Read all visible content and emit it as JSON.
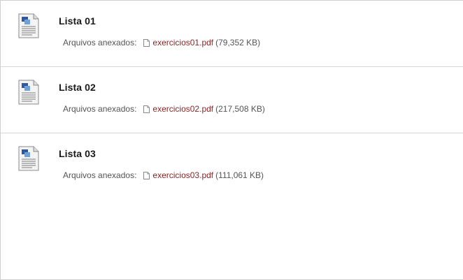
{
  "items": [
    {
      "title": "Lista 01",
      "attachments_label": "Arquivos anexados:",
      "file_name": "exercicios01.pdf",
      "file_size": "(79,352 KB)",
      "icon": "document-icon"
    },
    {
      "title": "Lista 02",
      "attachments_label": "Arquivos anexados:",
      "file_name": "exercicios02.pdf",
      "file_size": "(217,508 KB)",
      "icon": "document-icon"
    },
    {
      "title": "Lista 03",
      "attachments_label": "Arquivos anexados:",
      "file_name": "exercicios03.pdf",
      "file_size": "(111,061 KB)",
      "icon": "document-icon"
    }
  ],
  "colors": {
    "link": "#8b2525",
    "border": "#d6d6d6",
    "title": "#1a1a1a",
    "text": "#555555"
  }
}
